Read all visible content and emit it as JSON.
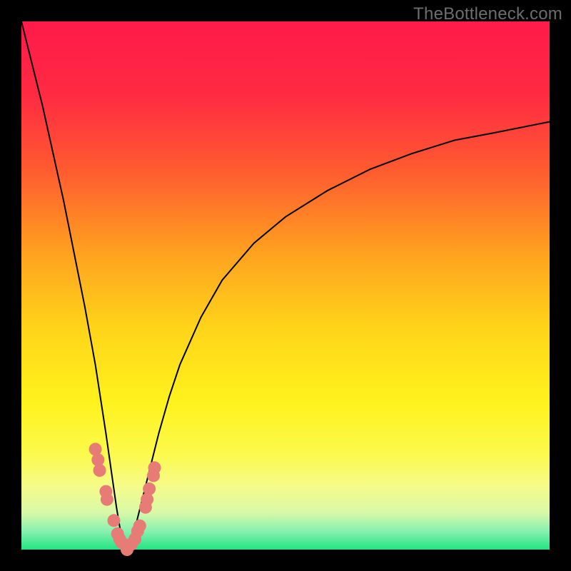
{
  "watermark": "TheBottleneck.com",
  "colors": {
    "frame": "#000000",
    "curve": "#000000",
    "markers": "#e77c77",
    "gradient_stops": [
      {
        "pos": 0.0,
        "color": "#ff1a4a"
      },
      {
        "pos": 0.14,
        "color": "#ff2b42"
      },
      {
        "pos": 0.28,
        "color": "#ff5a30"
      },
      {
        "pos": 0.44,
        "color": "#ffa21f"
      },
      {
        "pos": 0.58,
        "color": "#ffd41a"
      },
      {
        "pos": 0.72,
        "color": "#fff21c"
      },
      {
        "pos": 0.82,
        "color": "#fbfa4d"
      },
      {
        "pos": 0.88,
        "color": "#f6fb8a"
      },
      {
        "pos": 0.93,
        "color": "#d8f9a8"
      },
      {
        "pos": 0.965,
        "color": "#88f0b0"
      },
      {
        "pos": 1.0,
        "color": "#22e583"
      }
    ]
  },
  "chart_data": {
    "type": "line",
    "title": "",
    "xlabel": "",
    "ylabel": "",
    "xlim": [
      0,
      100
    ],
    "ylim": [
      0,
      100
    ],
    "grid": false,
    "legend": false,
    "note": "V-shaped bottleneck curve. Values estimated from pixel positions; minimum (~0) around x≈20; curve rises rapidly to ~100 at x≈0 and gradually toward ~80 at x≈100.",
    "series": [
      {
        "name": "bottleneck_curve",
        "x": [
          0,
          2,
          4,
          6,
          8,
          10,
          12,
          14,
          16,
          18,
          19,
          20,
          21,
          22,
          24,
          26,
          28,
          30,
          34,
          38,
          44,
          50,
          58,
          66,
          74,
          82,
          90,
          100
        ],
        "y": [
          100,
          92,
          84,
          75,
          66,
          56,
          46,
          35,
          22,
          8,
          2,
          0,
          2,
          6,
          14,
          22,
          29,
          35,
          44,
          51,
          58,
          63,
          68,
          72,
          75,
          77.5,
          79,
          81
        ]
      }
    ],
    "markers": {
      "name": "highlighted_points",
      "note": "Clusters of scatter points on both flanks of the V near the minimum, within the green/yellow band (y≲18).",
      "x": [
        14.0,
        14.5,
        14.8,
        16.0,
        16.2,
        17.5,
        18.2,
        18.6,
        19.0,
        20.0,
        20.8,
        21.5,
        22.0,
        22.4,
        23.5,
        23.8,
        24.2,
        25.0,
        25.2
      ],
      "y": [
        19.0,
        17.0,
        15.0,
        11.0,
        9.5,
        5.5,
        3.0,
        2.0,
        1.3,
        0.0,
        1.0,
        2.0,
        3.5,
        4.5,
        8.0,
        9.5,
        11.5,
        14.0,
        15.5
      ]
    }
  }
}
